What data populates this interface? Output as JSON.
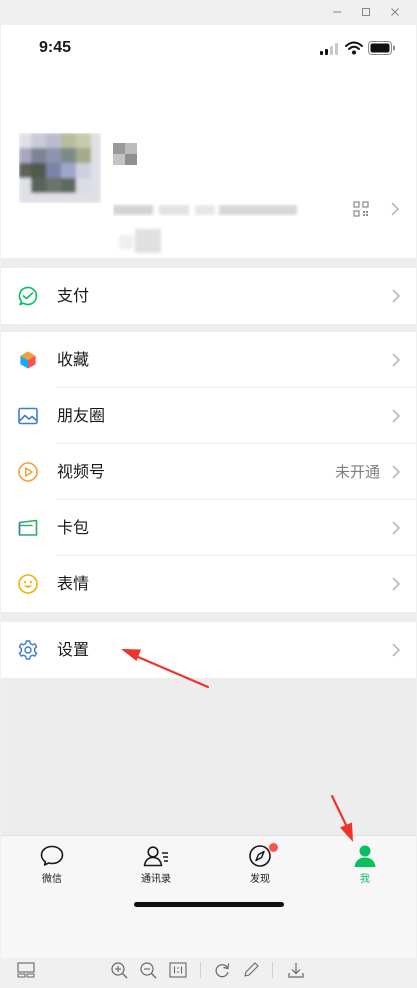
{
  "status_bar": {
    "time": "9:45"
  },
  "menu": {
    "pay": {
      "label": "支付"
    },
    "items": [
      {
        "label": "收藏",
        "value": ""
      },
      {
        "label": "朋友圈",
        "value": ""
      },
      {
        "label": "视频号",
        "value": "未开通"
      },
      {
        "label": "卡包",
        "value": ""
      },
      {
        "label": "表情",
        "value": ""
      }
    ],
    "settings": {
      "label": "设置"
    }
  },
  "tabbar": {
    "tabs": [
      {
        "label": "微信",
        "icon": "chat-icon"
      },
      {
        "label": "通讯录",
        "icon": "contacts-icon"
      },
      {
        "label": "发现",
        "icon": "compass-icon"
      },
      {
        "label": "我",
        "icon": "person-icon"
      }
    ],
    "active_tab": "我"
  },
  "colors": {
    "accent_green": "#07c160",
    "badge_red": "#fa5151",
    "arrow_red": "#f0322d"
  }
}
